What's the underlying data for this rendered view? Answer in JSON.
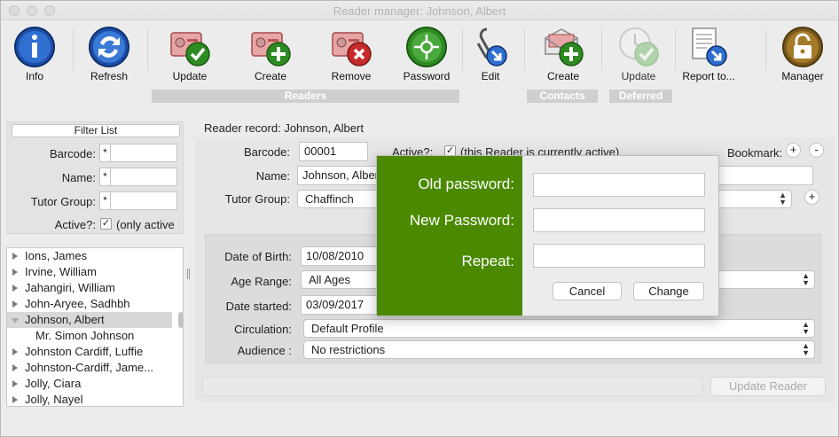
{
  "window": {
    "title": "Reader manager: Johnson, Albert"
  },
  "toolbar": {
    "buttons": [
      {
        "label": "Info",
        "icon": "info-icon"
      },
      {
        "label": "Refresh",
        "icon": "refresh-icon"
      },
      {
        "label": "Update",
        "icon": "reader-update-icon"
      },
      {
        "label": "Create",
        "icon": "reader-create-icon"
      },
      {
        "label": "Remove",
        "icon": "reader-remove-icon"
      },
      {
        "label": "Password",
        "icon": "password-icon"
      },
      {
        "label": "Edit",
        "icon": "edit-icon"
      },
      {
        "label": "Create",
        "icon": "contact-create-icon"
      },
      {
        "label": "Update",
        "icon": "deferred-update-icon"
      },
      {
        "label": "Report to...",
        "icon": "report-icon"
      },
      {
        "label": "Manager",
        "icon": "manager-lock-icon"
      }
    ],
    "groups": {
      "readers": "Readers",
      "contacts": "Contacts",
      "deferred": "Deferred"
    }
  },
  "filter": {
    "button": "Filter List",
    "barcode_label": "Barcode:",
    "name_label": "Name:",
    "tutor_group_label": "Tutor Group:",
    "active_label": "Active?:",
    "active_text": "(only active",
    "wildcard": "*",
    "active_checked": "✓"
  },
  "list": {
    "items": [
      {
        "text": "Ions,  James",
        "expanded": false
      },
      {
        "text": "Irvine,  William",
        "expanded": false
      },
      {
        "text": "Jahangiri,  William",
        "expanded": false
      },
      {
        "text": "John-Aryee,  Sadhbh",
        "expanded": false
      },
      {
        "text": "Johnson, Albert",
        "expanded": true,
        "selected": true
      },
      {
        "text": "Mr. Simon Johnson",
        "child": true
      },
      {
        "text": "Johnston Cardiff,  Luffie",
        "expanded": false
      },
      {
        "text": "Johnston-Cardiff,  Jame...",
        "expanded": false
      },
      {
        "text": "Jolly,  Ciara",
        "expanded": false
      },
      {
        "text": "Jolly,  Nayel",
        "expanded": false
      }
    ]
  },
  "record": {
    "title": "Reader record: Johnson, Albert",
    "barcode_label": "Barcode:",
    "barcode": "00001",
    "active_label": "Active?:",
    "active_text": "(this Reader is currently active)",
    "active_checked": "✓",
    "bookmark_label": "Bookmark:",
    "name_label": "Name:",
    "name": "Johnson, Albert",
    "tutor_group_label": "Tutor Group:",
    "tutor_group": "Chaffinch",
    "dob_label": "Date of Birth:",
    "dob": "10/08/2010",
    "age_range_label": "Age Range:",
    "age_range": "All Ages",
    "date_started_label": "Date started:",
    "date_started": "03/09/2017",
    "circulation_label": "Circulation:",
    "circulation": "Default Profile",
    "audience_label": "Audience :",
    "audience": "No restrictions",
    "update_button": "Update Reader",
    "plus": "+",
    "minus": "-"
  },
  "password_dialog": {
    "old_label": "Old password:",
    "new_label": "New Password:",
    "repeat_label": "Repeat:",
    "cancel": "Cancel",
    "change": "Change",
    "accent": "#4b8a00"
  }
}
